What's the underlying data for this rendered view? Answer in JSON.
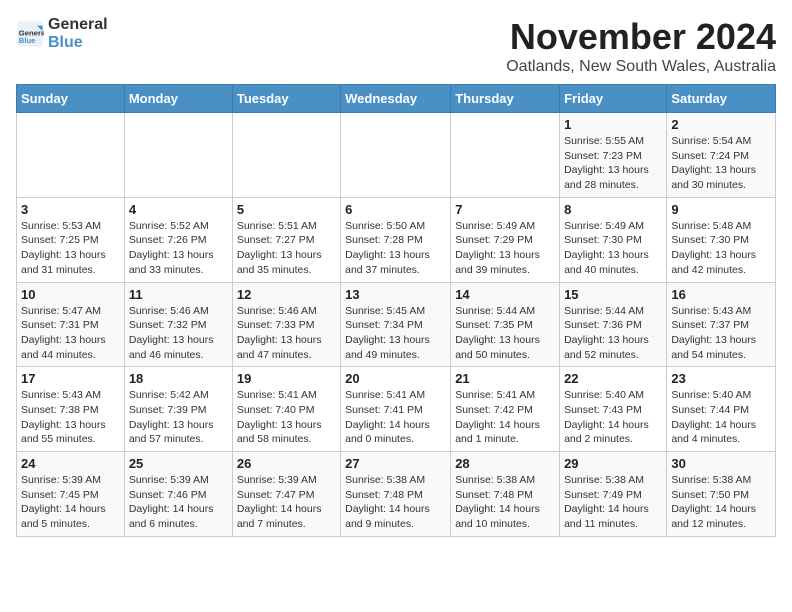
{
  "header": {
    "logo_general": "General",
    "logo_blue": "Blue",
    "title": "November 2024",
    "subtitle": "Oatlands, New South Wales, Australia"
  },
  "weekdays": [
    "Sunday",
    "Monday",
    "Tuesday",
    "Wednesday",
    "Thursday",
    "Friday",
    "Saturday"
  ],
  "weeks": [
    [
      {
        "day": "",
        "info": ""
      },
      {
        "day": "",
        "info": ""
      },
      {
        "day": "",
        "info": ""
      },
      {
        "day": "",
        "info": ""
      },
      {
        "day": "",
        "info": ""
      },
      {
        "day": "1",
        "info": "Sunrise: 5:55 AM\nSunset: 7:23 PM\nDaylight: 13 hours and 28 minutes."
      },
      {
        "day": "2",
        "info": "Sunrise: 5:54 AM\nSunset: 7:24 PM\nDaylight: 13 hours and 30 minutes."
      }
    ],
    [
      {
        "day": "3",
        "info": "Sunrise: 5:53 AM\nSunset: 7:25 PM\nDaylight: 13 hours and 31 minutes."
      },
      {
        "day": "4",
        "info": "Sunrise: 5:52 AM\nSunset: 7:26 PM\nDaylight: 13 hours and 33 minutes."
      },
      {
        "day": "5",
        "info": "Sunrise: 5:51 AM\nSunset: 7:27 PM\nDaylight: 13 hours and 35 minutes."
      },
      {
        "day": "6",
        "info": "Sunrise: 5:50 AM\nSunset: 7:28 PM\nDaylight: 13 hours and 37 minutes."
      },
      {
        "day": "7",
        "info": "Sunrise: 5:49 AM\nSunset: 7:29 PM\nDaylight: 13 hours and 39 minutes."
      },
      {
        "day": "8",
        "info": "Sunrise: 5:49 AM\nSunset: 7:30 PM\nDaylight: 13 hours and 40 minutes."
      },
      {
        "day": "9",
        "info": "Sunrise: 5:48 AM\nSunset: 7:30 PM\nDaylight: 13 hours and 42 minutes."
      }
    ],
    [
      {
        "day": "10",
        "info": "Sunrise: 5:47 AM\nSunset: 7:31 PM\nDaylight: 13 hours and 44 minutes."
      },
      {
        "day": "11",
        "info": "Sunrise: 5:46 AM\nSunset: 7:32 PM\nDaylight: 13 hours and 46 minutes."
      },
      {
        "day": "12",
        "info": "Sunrise: 5:46 AM\nSunset: 7:33 PM\nDaylight: 13 hours and 47 minutes."
      },
      {
        "day": "13",
        "info": "Sunrise: 5:45 AM\nSunset: 7:34 PM\nDaylight: 13 hours and 49 minutes."
      },
      {
        "day": "14",
        "info": "Sunrise: 5:44 AM\nSunset: 7:35 PM\nDaylight: 13 hours and 50 minutes."
      },
      {
        "day": "15",
        "info": "Sunrise: 5:44 AM\nSunset: 7:36 PM\nDaylight: 13 hours and 52 minutes."
      },
      {
        "day": "16",
        "info": "Sunrise: 5:43 AM\nSunset: 7:37 PM\nDaylight: 13 hours and 54 minutes."
      }
    ],
    [
      {
        "day": "17",
        "info": "Sunrise: 5:43 AM\nSunset: 7:38 PM\nDaylight: 13 hours and 55 minutes."
      },
      {
        "day": "18",
        "info": "Sunrise: 5:42 AM\nSunset: 7:39 PM\nDaylight: 13 hours and 57 minutes."
      },
      {
        "day": "19",
        "info": "Sunrise: 5:41 AM\nSunset: 7:40 PM\nDaylight: 13 hours and 58 minutes."
      },
      {
        "day": "20",
        "info": "Sunrise: 5:41 AM\nSunset: 7:41 PM\nDaylight: 14 hours and 0 minutes."
      },
      {
        "day": "21",
        "info": "Sunrise: 5:41 AM\nSunset: 7:42 PM\nDaylight: 14 hours and 1 minute."
      },
      {
        "day": "22",
        "info": "Sunrise: 5:40 AM\nSunset: 7:43 PM\nDaylight: 14 hours and 2 minutes."
      },
      {
        "day": "23",
        "info": "Sunrise: 5:40 AM\nSunset: 7:44 PM\nDaylight: 14 hours and 4 minutes."
      }
    ],
    [
      {
        "day": "24",
        "info": "Sunrise: 5:39 AM\nSunset: 7:45 PM\nDaylight: 14 hours and 5 minutes."
      },
      {
        "day": "25",
        "info": "Sunrise: 5:39 AM\nSunset: 7:46 PM\nDaylight: 14 hours and 6 minutes."
      },
      {
        "day": "26",
        "info": "Sunrise: 5:39 AM\nSunset: 7:47 PM\nDaylight: 14 hours and 7 minutes."
      },
      {
        "day": "27",
        "info": "Sunrise: 5:38 AM\nSunset: 7:48 PM\nDaylight: 14 hours and 9 minutes."
      },
      {
        "day": "28",
        "info": "Sunrise: 5:38 AM\nSunset: 7:48 PM\nDaylight: 14 hours and 10 minutes."
      },
      {
        "day": "29",
        "info": "Sunrise: 5:38 AM\nSunset: 7:49 PM\nDaylight: 14 hours and 11 minutes."
      },
      {
        "day": "30",
        "info": "Sunrise: 5:38 AM\nSunset: 7:50 PM\nDaylight: 14 hours and 12 minutes."
      }
    ]
  ]
}
